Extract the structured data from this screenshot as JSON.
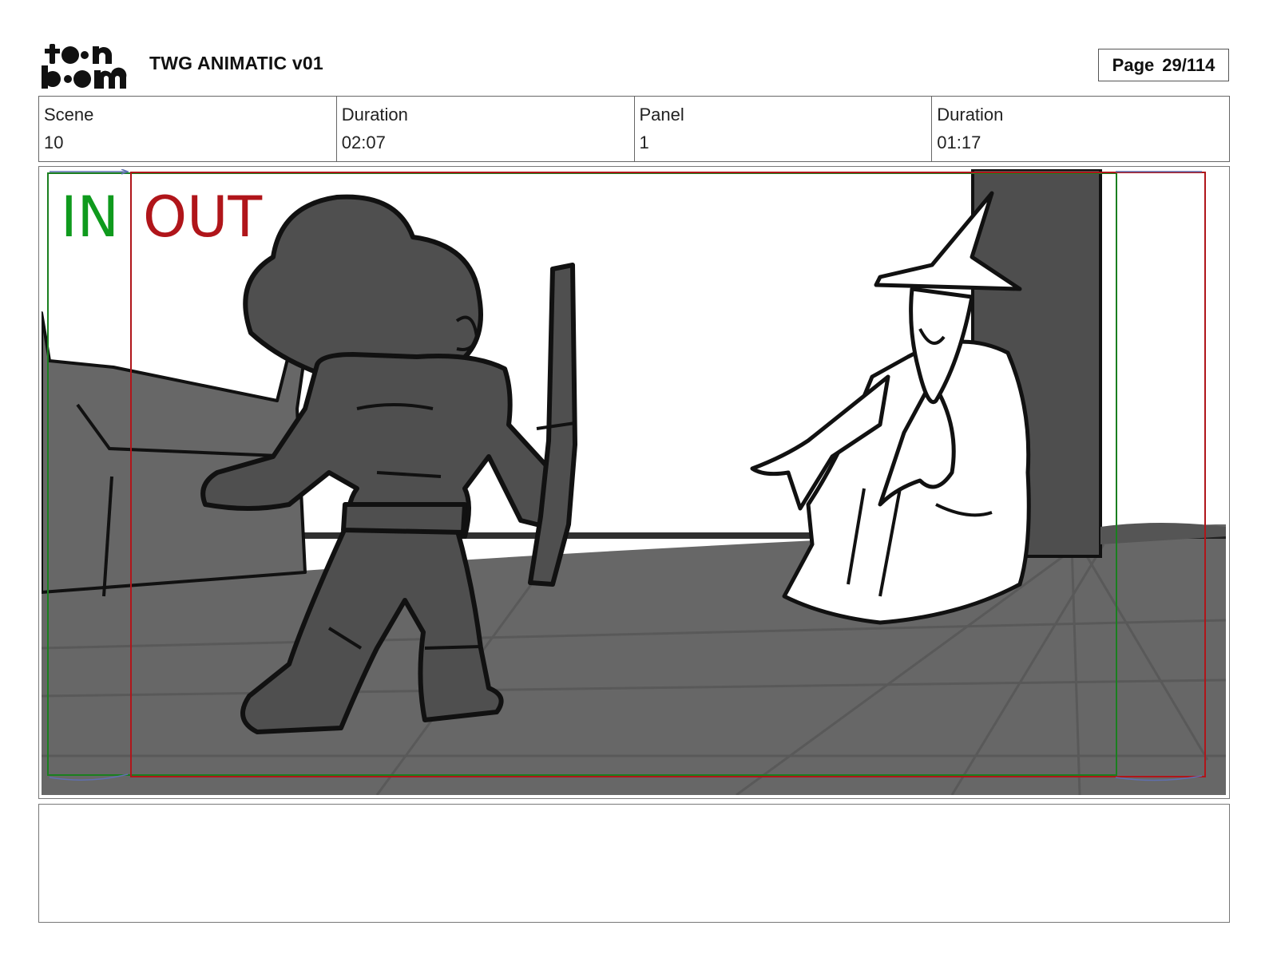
{
  "header": {
    "logo_text_top": "toon",
    "logo_text_bottom": "boom",
    "doc_title": "TWG ANIMATIC v01",
    "page_label": "Page",
    "page_value": "29/114"
  },
  "info": [
    {
      "label": "Scene",
      "value": "10"
    },
    {
      "label": "Duration",
      "value": "02:07"
    },
    {
      "label": "Panel",
      "value": "1"
    },
    {
      "label": "Duration",
      "value": "01:17"
    }
  ],
  "panel": {
    "in_label": "IN",
    "out_label": "OUT",
    "colors": {
      "in_frame": "#0f8a1d",
      "out_frame": "#b0151a",
      "floor": "#656565",
      "dark_fill": "#4d4d4d",
      "line": "#111111"
    }
  },
  "notes": {
    "text": ""
  }
}
